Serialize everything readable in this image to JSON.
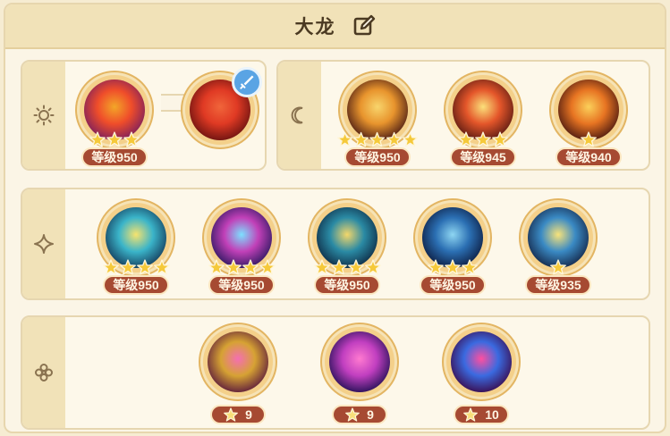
{
  "header": {
    "title": "大龙",
    "edit_icon": "edit-icon"
  },
  "panels": {
    "sun": {
      "icon": "sun-icon",
      "slots": [
        {
          "name": "sun-card-1",
          "stars": 3,
          "level": "等级950",
          "palette": [
            "#ef4d2a",
            "#7b1e5e",
            "#f3a628"
          ]
        },
        {
          "name": "sun-card-2",
          "stars": 0,
          "level": "",
          "badge": "sword-icon",
          "palette": [
            "#e03a24",
            "#6b1210",
            "#f0653a"
          ]
        }
      ]
    },
    "moon": {
      "icon": "moon-icon",
      "slots": [
        {
          "name": "moon-card-1",
          "stars": 5,
          "level": "等级950",
          "palette": [
            "#e8942d",
            "#4b1c14",
            "#f8d56c"
          ]
        },
        {
          "name": "moon-card-2",
          "stars": 3,
          "level": "等级945",
          "palette": [
            "#e4562a",
            "#5a1a12",
            "#fbe07a"
          ]
        },
        {
          "name": "moon-card-3",
          "stars": 1,
          "level": "等级940",
          "palette": [
            "#e77422",
            "#4a1810",
            "#fbd05a"
          ]
        }
      ]
    },
    "spark": {
      "icon": "sparkle-icon",
      "slots": [
        {
          "name": "spark-card-1",
          "stars": 4,
          "level": "等级950",
          "palette": [
            "#3ab4c9",
            "#143a5a",
            "#f7e36e"
          ]
        },
        {
          "name": "spark-card-2",
          "stars": 4,
          "level": "等级950",
          "palette": [
            "#c140b8",
            "#2c1860",
            "#7de0ff"
          ]
        },
        {
          "name": "spark-card-3",
          "stars": 4,
          "level": "等级950",
          "palette": [
            "#2a8aa4",
            "#0e2a44",
            "#f4d76a"
          ]
        },
        {
          "name": "spark-card-4",
          "stars": 3,
          "level": "等级950",
          "palette": [
            "#2b6fb3",
            "#0c1c40",
            "#8ed6f2"
          ]
        },
        {
          "name": "spark-card-5",
          "stars": 1,
          "level": "等级935",
          "palette": [
            "#3a8ac4",
            "#142648",
            "#f8e37a"
          ]
        }
      ]
    },
    "flower": {
      "icon": "flower-icon",
      "slots": [
        {
          "name": "relic-1",
          "count": "9",
          "palette": [
            "#d6a233",
            "#5c1a3c",
            "#f46fb2"
          ]
        },
        {
          "name": "relic-2",
          "count": "9",
          "palette": [
            "#c13fc0",
            "#241056",
            "#ff7ad0"
          ]
        },
        {
          "name": "relic-3",
          "count": "10",
          "palette": [
            "#3a6ae0",
            "#3a0a4c",
            "#ff4fa0"
          ]
        }
      ]
    }
  },
  "colors": {
    "background": "#f6ecd2",
    "header": "#f1e2b8",
    "level_badge": "#a64a32",
    "star": "#f5c93a",
    "accent_blue": "#5aa4e4"
  }
}
